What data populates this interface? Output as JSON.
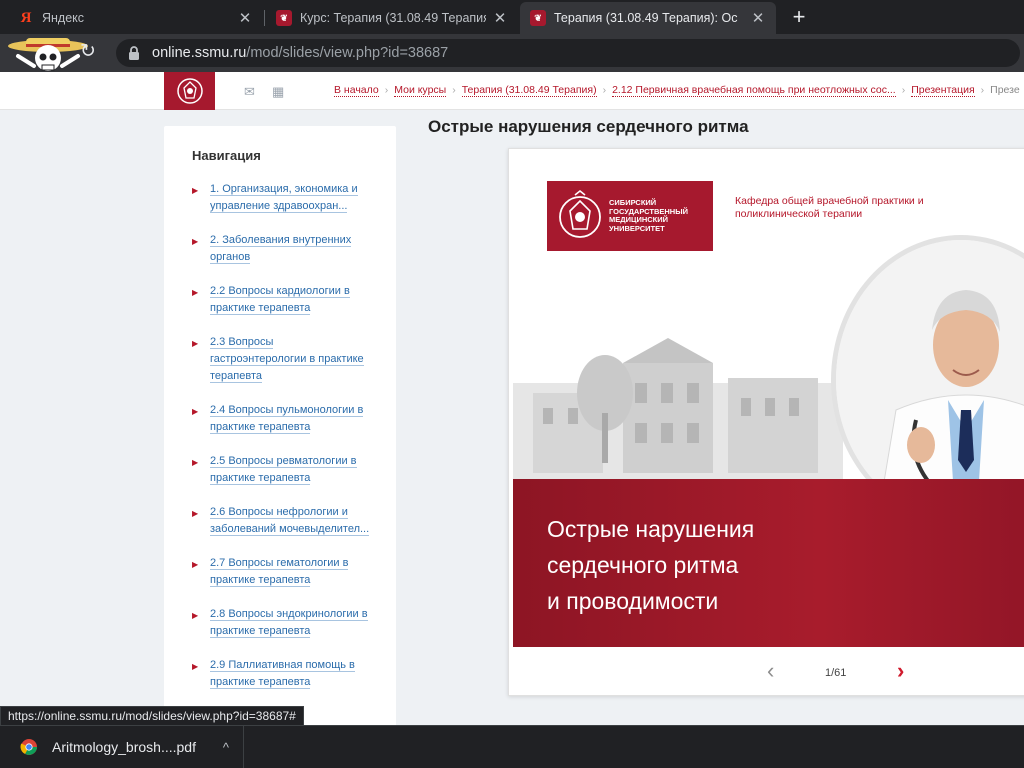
{
  "browser": {
    "tabs": [
      {
        "label": "Яндекс",
        "favicon": "yandex-icon",
        "active": false
      },
      {
        "label": "Курс: Терапия (31.08.49 Терапия",
        "favicon": "ssmu-icon",
        "active": false
      },
      {
        "label": "Терапия (31.08.49 Терапия): Ос",
        "favicon": "ssmu-icon",
        "active": true
      }
    ],
    "new_tab_label": "+",
    "close_glyph": "✕",
    "url_host": "online.ssmu.ru",
    "url_path": "/mod/slides/view.php?id=38687",
    "status_url": "https://online.ssmu.ru/mod/slides/view.php?id=38687#"
  },
  "page": {
    "breadcrumbs": [
      "В начало",
      "Мои курсы",
      "Терапия (31.08.49 Терапия)",
      "2.12 Первичная врачебная помощь при неотложных сос...",
      "Презентация",
      "Презе"
    ],
    "navigation": {
      "title": "Навигация",
      "items": [
        "1. Организация, экономика и управление здравоохран...",
        "2. Заболевания внутренних органов",
        "2.2 Вопросы кардиологии в практике терапевта",
        "2.3 Вопросы гастроэнтерологии в практике терапевта",
        "2.4 Вопросы пульмонологии в практике терапевта",
        "2.5 Вопросы ревматологии в практике терапевта",
        "2.6 Вопросы нефрологии и заболеваний мочевыделител...",
        "2.7 Вопросы гематологии в практике терапевта",
        "2.8 Вопросы эндокринологии в практике терапевта",
        "2.9 Паллиативная помощь в практике терапевта"
      ]
    },
    "title": "Острые нарушения сердечного ритма",
    "slide": {
      "university": "СИБИРСКИЙ ГОСУДАРСТВЕННЫЙ МЕДИЦИНСКИЙ УНИВЕРСИТЕТ",
      "department": "Кафедра общей врачебной практики и поликлинической терапии",
      "heading_lines": [
        "Острые нарушения",
        "сердечного ритма",
        "и проводимости"
      ]
    },
    "pager": {
      "prev": "‹",
      "next": "›",
      "count": "1/61"
    }
  },
  "downloads": {
    "file_name": "Aritmology_brosh....pdf",
    "caret": "^"
  },
  "colors": {
    "brand_red": "#a6192e",
    "link_blue": "#2b6cab",
    "chrome_dark": "#202124"
  }
}
